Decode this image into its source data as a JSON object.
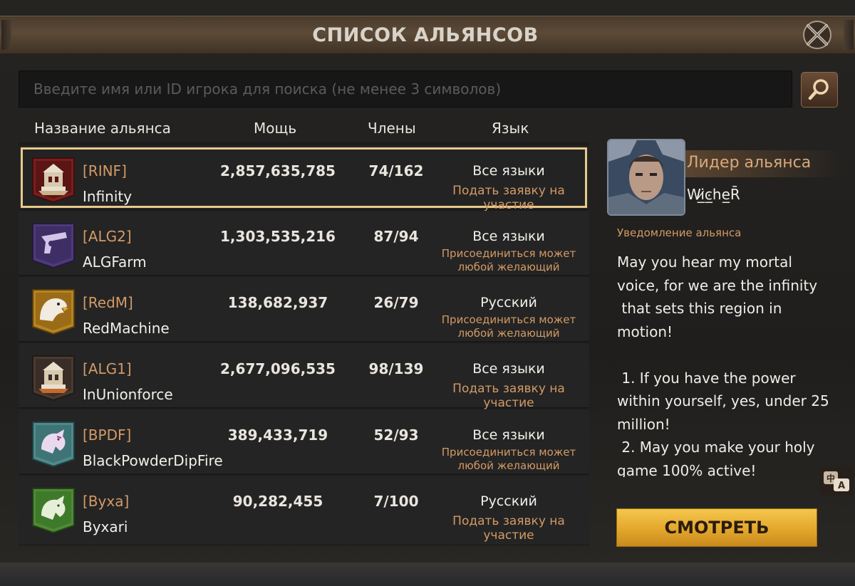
{
  "window": {
    "title": "СПИСОК АЛЬЯНСОВ"
  },
  "search": {
    "placeholder": "Введите имя или ID игрока для поиска (не менее 3 символов)",
    "value": ""
  },
  "columns": {
    "name": "Название альянса",
    "power": "Мощь",
    "members": "Члены",
    "language": "Язык"
  },
  "alliances": [
    {
      "tag": "[RINF]",
      "name": "Infinity",
      "power": "2,857,635,785",
      "members": "74/162",
      "language": "Все языки",
      "join": "Подать заявку на участие",
      "emblem": "castle-emblem-red"
    },
    {
      "tag": "[ALG2]",
      "name": "ALGFarm",
      "power": "1,303,535,216",
      "members": "87/94",
      "language": "Все языки",
      "join": "Присоединиться может любой желающий",
      "emblem": "pistol-emblem-purple"
    },
    {
      "tag": "[RedM]",
      "name": "RedMachine",
      "power": "138,682,937",
      "members": "26/79",
      "language": "Русский",
      "join": "Присоединиться может любой желающий",
      "emblem": "eagle-emblem-gold"
    },
    {
      "tag": "[ALG1]",
      "name": "InUnionforce",
      "power": "2,677,096,535",
      "members": "98/139",
      "language": "Все языки",
      "join": "Подать заявку на участие",
      "emblem": "castle-emblem-dark"
    },
    {
      "tag": "[BPDF]",
      "name": "BlackPowderDipFire",
      "power": "389,433,719",
      "members": "52/93",
      "language": "Все языки",
      "join": "Присоединиться может любой желающий",
      "emblem": "dragon-emblem-teal"
    },
    {
      "tag": "[Byxa]",
      "name": "Byxari",
      "power": "90,282,455",
      "members": "7/100",
      "language": "Русский",
      "join": "Подать заявку на участие",
      "emblem": "dragon-emblem-green"
    }
  ],
  "leader": {
    "label": "Лидер альянса",
    "name": "Wi̷̲ͼ̲he̲R̄"
  },
  "notice": {
    "title": "Уведомление альянса",
    "text": "May you hear my mortal voice, for we are the infinity\n that sets this region in motion!\n\n 1. If you have the power within yourself, yes, under 25 million!\n 2. May you make your holy game 100% active!"
  },
  "actions": {
    "view": "СМОТРЕТЬ"
  },
  "colors": {
    "accent": "#d39a66",
    "selected_outline": "#e8c98d",
    "button_gold": "#e3a72c"
  }
}
